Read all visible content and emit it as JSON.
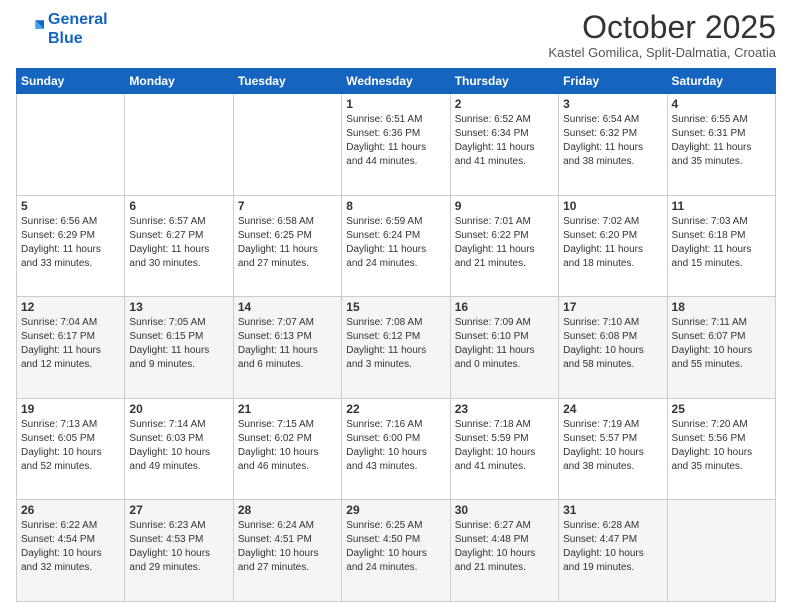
{
  "header": {
    "logo_line1": "General",
    "logo_line2": "Blue",
    "month": "October 2025",
    "location": "Kastel Gomilica, Split-Dalmatia, Croatia"
  },
  "days_of_week": [
    "Sunday",
    "Monday",
    "Tuesday",
    "Wednesday",
    "Thursday",
    "Friday",
    "Saturday"
  ],
  "weeks": [
    [
      {
        "num": "",
        "info": ""
      },
      {
        "num": "",
        "info": ""
      },
      {
        "num": "",
        "info": ""
      },
      {
        "num": "1",
        "info": "Sunrise: 6:51 AM\nSunset: 6:36 PM\nDaylight: 11 hours\nand 44 minutes."
      },
      {
        "num": "2",
        "info": "Sunrise: 6:52 AM\nSunset: 6:34 PM\nDaylight: 11 hours\nand 41 minutes."
      },
      {
        "num": "3",
        "info": "Sunrise: 6:54 AM\nSunset: 6:32 PM\nDaylight: 11 hours\nand 38 minutes."
      },
      {
        "num": "4",
        "info": "Sunrise: 6:55 AM\nSunset: 6:31 PM\nDaylight: 11 hours\nand 35 minutes."
      }
    ],
    [
      {
        "num": "5",
        "info": "Sunrise: 6:56 AM\nSunset: 6:29 PM\nDaylight: 11 hours\nand 33 minutes."
      },
      {
        "num": "6",
        "info": "Sunrise: 6:57 AM\nSunset: 6:27 PM\nDaylight: 11 hours\nand 30 minutes."
      },
      {
        "num": "7",
        "info": "Sunrise: 6:58 AM\nSunset: 6:25 PM\nDaylight: 11 hours\nand 27 minutes."
      },
      {
        "num": "8",
        "info": "Sunrise: 6:59 AM\nSunset: 6:24 PM\nDaylight: 11 hours\nand 24 minutes."
      },
      {
        "num": "9",
        "info": "Sunrise: 7:01 AM\nSunset: 6:22 PM\nDaylight: 11 hours\nand 21 minutes."
      },
      {
        "num": "10",
        "info": "Sunrise: 7:02 AM\nSunset: 6:20 PM\nDaylight: 11 hours\nand 18 minutes."
      },
      {
        "num": "11",
        "info": "Sunrise: 7:03 AM\nSunset: 6:18 PM\nDaylight: 11 hours\nand 15 minutes."
      }
    ],
    [
      {
        "num": "12",
        "info": "Sunrise: 7:04 AM\nSunset: 6:17 PM\nDaylight: 11 hours\nand 12 minutes."
      },
      {
        "num": "13",
        "info": "Sunrise: 7:05 AM\nSunset: 6:15 PM\nDaylight: 11 hours\nand 9 minutes."
      },
      {
        "num": "14",
        "info": "Sunrise: 7:07 AM\nSunset: 6:13 PM\nDaylight: 11 hours\nand 6 minutes."
      },
      {
        "num": "15",
        "info": "Sunrise: 7:08 AM\nSunset: 6:12 PM\nDaylight: 11 hours\nand 3 minutes."
      },
      {
        "num": "16",
        "info": "Sunrise: 7:09 AM\nSunset: 6:10 PM\nDaylight: 11 hours\nand 0 minutes."
      },
      {
        "num": "17",
        "info": "Sunrise: 7:10 AM\nSunset: 6:08 PM\nDaylight: 10 hours\nand 58 minutes."
      },
      {
        "num": "18",
        "info": "Sunrise: 7:11 AM\nSunset: 6:07 PM\nDaylight: 10 hours\nand 55 minutes."
      }
    ],
    [
      {
        "num": "19",
        "info": "Sunrise: 7:13 AM\nSunset: 6:05 PM\nDaylight: 10 hours\nand 52 minutes."
      },
      {
        "num": "20",
        "info": "Sunrise: 7:14 AM\nSunset: 6:03 PM\nDaylight: 10 hours\nand 49 minutes."
      },
      {
        "num": "21",
        "info": "Sunrise: 7:15 AM\nSunset: 6:02 PM\nDaylight: 10 hours\nand 46 minutes."
      },
      {
        "num": "22",
        "info": "Sunrise: 7:16 AM\nSunset: 6:00 PM\nDaylight: 10 hours\nand 43 minutes."
      },
      {
        "num": "23",
        "info": "Sunrise: 7:18 AM\nSunset: 5:59 PM\nDaylight: 10 hours\nand 41 minutes."
      },
      {
        "num": "24",
        "info": "Sunrise: 7:19 AM\nSunset: 5:57 PM\nDaylight: 10 hours\nand 38 minutes."
      },
      {
        "num": "25",
        "info": "Sunrise: 7:20 AM\nSunset: 5:56 PM\nDaylight: 10 hours\nand 35 minutes."
      }
    ],
    [
      {
        "num": "26",
        "info": "Sunrise: 6:22 AM\nSunset: 4:54 PM\nDaylight: 10 hours\nand 32 minutes."
      },
      {
        "num": "27",
        "info": "Sunrise: 6:23 AM\nSunset: 4:53 PM\nDaylight: 10 hours\nand 29 minutes."
      },
      {
        "num": "28",
        "info": "Sunrise: 6:24 AM\nSunset: 4:51 PM\nDaylight: 10 hours\nand 27 minutes."
      },
      {
        "num": "29",
        "info": "Sunrise: 6:25 AM\nSunset: 4:50 PM\nDaylight: 10 hours\nand 24 minutes."
      },
      {
        "num": "30",
        "info": "Sunrise: 6:27 AM\nSunset: 4:48 PM\nDaylight: 10 hours\nand 21 minutes."
      },
      {
        "num": "31",
        "info": "Sunrise: 6:28 AM\nSunset: 4:47 PM\nDaylight: 10 hours\nand 19 minutes."
      },
      {
        "num": "",
        "info": ""
      }
    ]
  ]
}
